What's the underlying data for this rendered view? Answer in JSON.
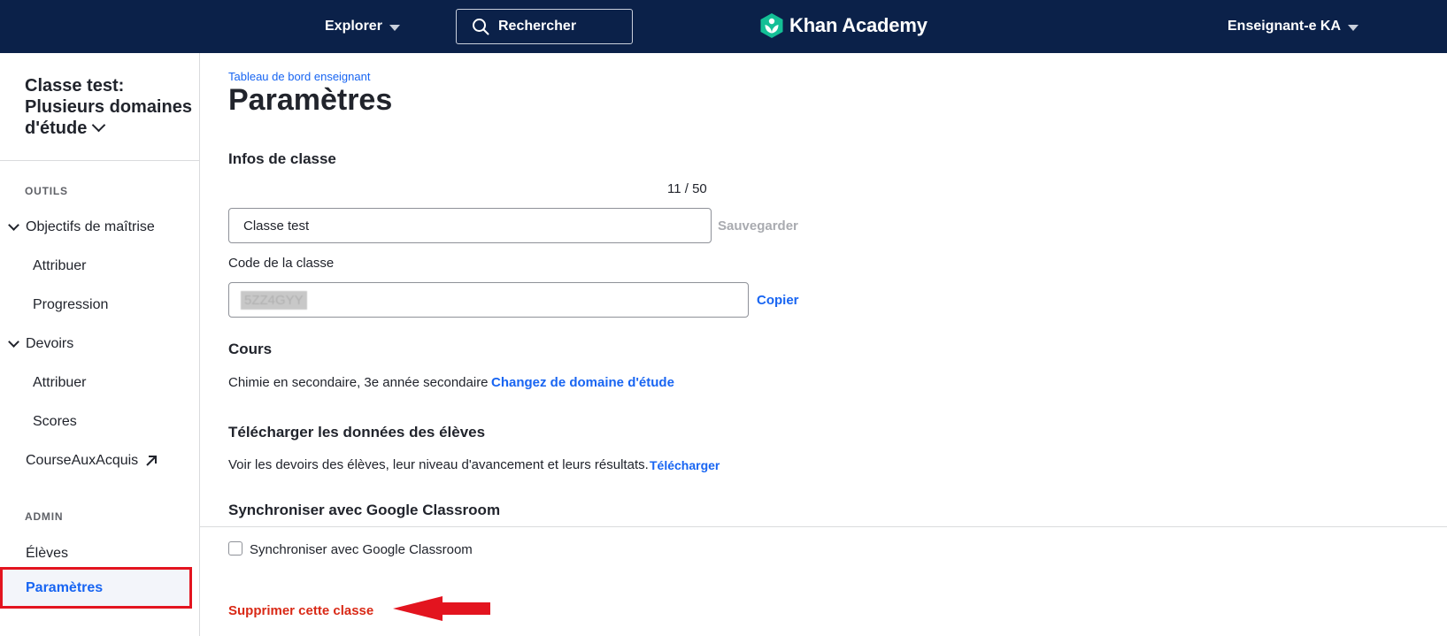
{
  "header": {
    "explore_label": "Explorer",
    "search_placeholder": "Rechercher",
    "logo_text": "Khan Academy",
    "user_label": "Enseignant-e KA",
    "colors": {
      "bar": "#0b2149",
      "logo_green": "#14bf96"
    }
  },
  "sidebar": {
    "class_title": "Classe test: Plusieurs domaines d'étude",
    "sections": {
      "tools": "OUTILS",
      "admin": "ADMIN"
    },
    "items": [
      {
        "label": "Objectifs de maîtrise"
      },
      {
        "label": "Attribuer"
      },
      {
        "label": "Progression"
      },
      {
        "label": "Devoirs"
      },
      {
        "label": "Attribuer"
      },
      {
        "label": "Scores"
      },
      {
        "label": "CourseAuxAcquis"
      },
      {
        "label": "Élèves"
      },
      {
        "label": "Paramètres"
      }
    ]
  },
  "main": {
    "breadcrumb": "Tableau de bord enseignant",
    "title": "Paramètres",
    "class_info": {
      "heading": "Infos de classe",
      "counter": "11 / 50",
      "name_value": "Classe test",
      "save_label": "Sauvegarder",
      "code_label": "Code de la classe",
      "code_value": "5ZZ4GYY",
      "copy_label": "Copier"
    },
    "courses": {
      "heading": "Cours",
      "value": "Chimie en secondaire, 3e année secondaire",
      "change_label": "Changez de domaine d'étude"
    },
    "download": {
      "heading": "Télécharger les données des élèves",
      "description": "Voir les devoirs des élèves, leur niveau d'avancement et leurs résultats.",
      "link_label": "Télécharger"
    },
    "google": {
      "heading": "Synchroniser avec Google Classroom",
      "checkbox_label": "Synchroniser avec Google Classroom",
      "checked": false
    },
    "delete_label": "Supprimer cette classe",
    "annotation_color": "#e3141f"
  }
}
